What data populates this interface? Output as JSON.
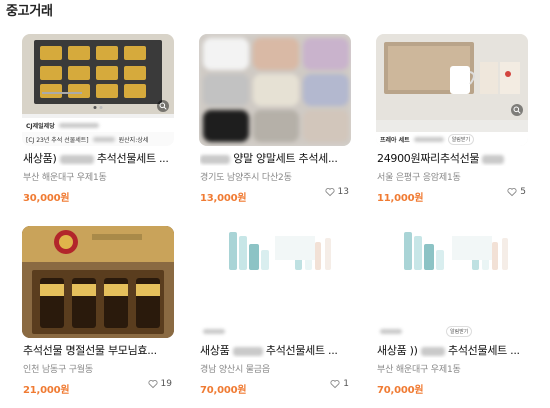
{
  "section_title": "중고거래",
  "listings": [
    {
      "title": "새상품)",
      "title_suffix": "추석선물세트 ...",
      "location": "부산 해운대구 우제1동",
      "price": "30,000원",
      "likes": "",
      "seller_strip": "CJ제일제당",
      "banner_text": "[CJ 23년 추석 선물세트]",
      "banner_tail": "원산지:상세"
    },
    {
      "title": "양말 양말세트 추석세...",
      "location": "경기도 남양주시 다산2동",
      "price": "13,000원",
      "likes": "13"
    },
    {
      "title": "24900원짜리추석선물",
      "location": "서울 은평구 응암제1동",
      "price": "11,000원",
      "likes": "5",
      "seller_strip": "프레아 세트",
      "badge": "알림받기"
    },
    {
      "title": "추석선물 명절선물 부모님효...",
      "location": "인천 남동구 구월동",
      "price": "21,000원",
      "likes": "19"
    },
    {
      "title": "새상품",
      "title_suffix": "추석선물세트 ...",
      "location": "경남 양산시 물금읍",
      "price": "70,000원",
      "likes": "1"
    },
    {
      "title": "새상품 ))",
      "title_suffix": "추석선물세트 ...",
      "location": "부산 해운대구 우제1동",
      "price": "70,000원",
      "likes": "",
      "badge": "알림받기"
    }
  ],
  "colors": {
    "price": "#f07b33",
    "muted": "#888888",
    "title": "#111111"
  },
  "icons": {
    "like": "heart-outline-icon",
    "zoom": "magnifier-icon"
  }
}
